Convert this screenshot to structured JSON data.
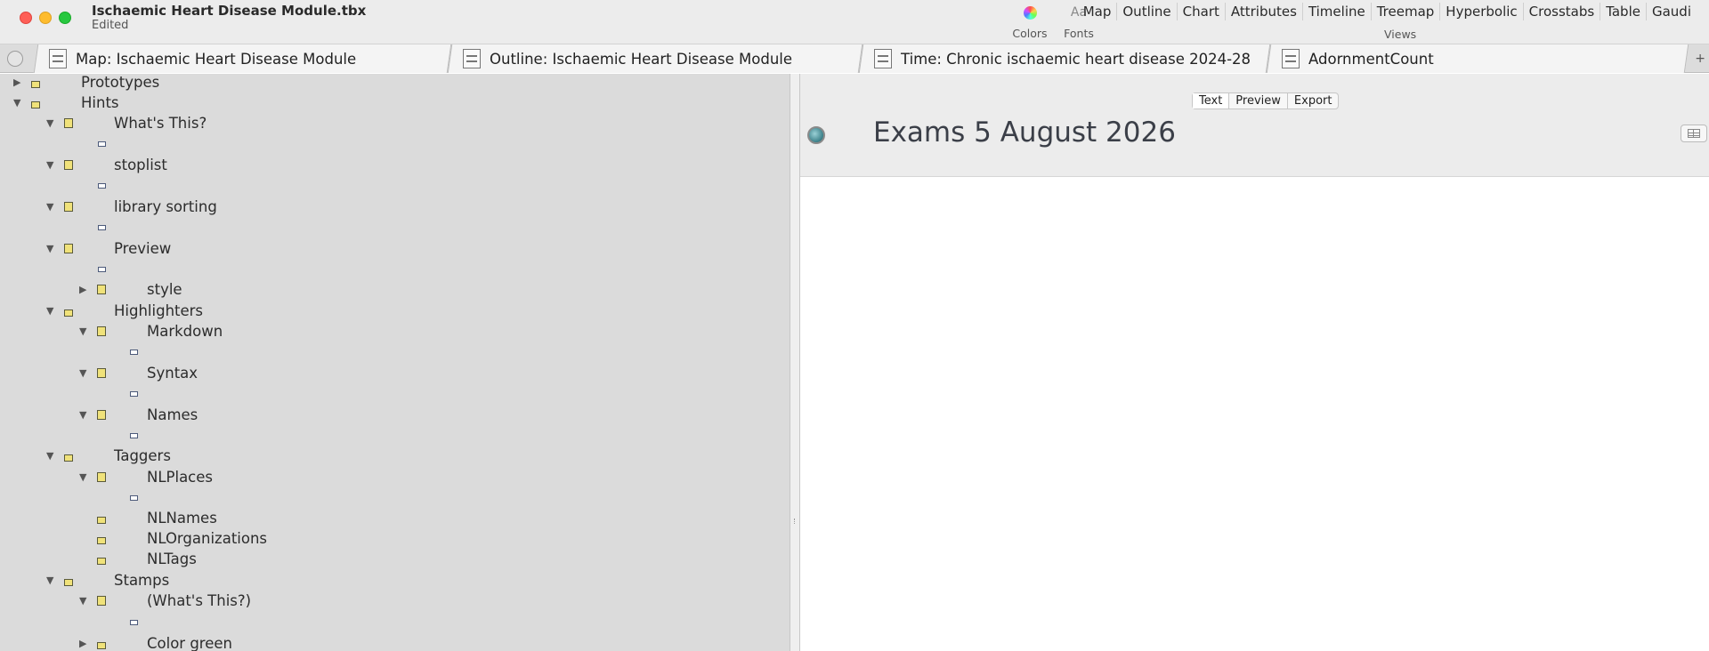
{
  "window": {
    "title": "Ischaemic Heart Disease Module.tbx",
    "status": "Edited"
  },
  "toolbar": {
    "colors_label": "Colors",
    "fonts_label": "Fonts",
    "fonts_glyph": "Aa",
    "views_label": "Views",
    "views": [
      "Map",
      "Outline",
      "Chart",
      "Attributes",
      "Timeline",
      "Treemap",
      "Hyperbolic",
      "Crosstabs",
      "Table",
      "Gaudi"
    ]
  },
  "tabs": [
    {
      "label": "Map: Ischaemic Heart Disease Module",
      "active": false
    },
    {
      "label": "Outline: Ischaemic Heart Disease Module",
      "active": true
    },
    {
      "label": "Time: Chronic ischaemic heart disease 2024-28",
      "active": false
    },
    {
      "label": "AdornmentCount",
      "active": false
    }
  ],
  "tab_add_glyph": "+",
  "outline": {
    "rows": [
      {
        "label": "Prototypes",
        "toggle": "▶"
      },
      {
        "label": "Hints",
        "toggle": "▼"
      },
      {
        "label": "What's This?",
        "toggle": "▼"
      },
      {
        "label": "",
        "toggle": ""
      },
      {
        "label": "stoplist",
        "toggle": "▼"
      },
      {
        "label": "",
        "toggle": ""
      },
      {
        "label": "library sorting",
        "toggle": "▼"
      },
      {
        "label": "",
        "toggle": ""
      },
      {
        "label": "Preview",
        "toggle": "▼"
      },
      {
        "label": "",
        "toggle": ""
      },
      {
        "label": "style",
        "toggle": "▶"
      },
      {
        "label": "Highlighters",
        "toggle": "▼"
      },
      {
        "label": "Markdown",
        "toggle": "▼"
      },
      {
        "label": "",
        "toggle": ""
      },
      {
        "label": "Syntax",
        "toggle": "▼"
      },
      {
        "label": "",
        "toggle": ""
      },
      {
        "label": "Names",
        "toggle": "▼"
      },
      {
        "label": "",
        "toggle": ""
      },
      {
        "label": "Taggers",
        "toggle": "▼"
      },
      {
        "label": "NLPlaces",
        "toggle": "▼"
      },
      {
        "label": "",
        "toggle": ""
      },
      {
        "label": "NLNames",
        "toggle": ""
      },
      {
        "label": "NLOrganizations",
        "toggle": ""
      },
      {
        "label": "NLTags",
        "toggle": ""
      },
      {
        "label": "Stamps",
        "toggle": "▼"
      },
      {
        "label": "(What's This?)",
        "toggle": "▼"
      },
      {
        "label": "",
        "toggle": ""
      },
      {
        "label": "Color green",
        "toggle": "▶"
      }
    ]
  },
  "text_pane": {
    "modes": [
      "Text",
      "Preview",
      "Export"
    ],
    "active_mode": "Text",
    "note_title": "Exams 5 August 2026"
  }
}
